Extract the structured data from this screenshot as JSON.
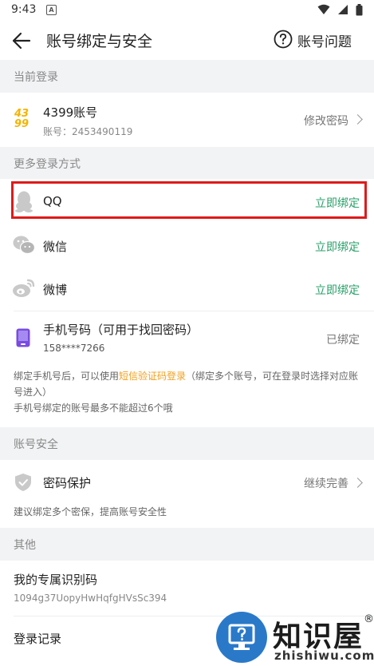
{
  "status_bar": {
    "time": "9:43",
    "app_indicator": "A"
  },
  "header": {
    "title": "账号绑定与安全",
    "help_label": "账号问题"
  },
  "sections": {
    "current_login": "当前登录",
    "more_login": "更多登录方式",
    "account_security": "账号安全",
    "other": "其他"
  },
  "current_account": {
    "logo_top": "43",
    "logo_bottom": "99",
    "title": "4399账号",
    "account_line": "账号：2453490119",
    "action": "修改密码"
  },
  "bindings": [
    {
      "icon": "qq-icon",
      "label": "QQ",
      "action": "立即绑定"
    },
    {
      "icon": "wechat-icon",
      "label": "微信",
      "action": "立即绑定"
    },
    {
      "icon": "weibo-icon",
      "label": "微博",
      "action": "立即绑定"
    }
  ],
  "phone": {
    "title": "手机号码（可用于找回密码）",
    "number": "158****7266",
    "status": "已绑定"
  },
  "phone_note": {
    "prefix": "绑定手机号后，可以使用",
    "highlight": "短信验证码登录",
    "suffix": "（绑定多个账号，可在登录时选择对应账号进入）",
    "line2": "手机号绑定的账号最多不能超过6个哦"
  },
  "password_protect": {
    "title": "密码保护",
    "action": "继续完善",
    "note": "建议绑定多个密保，提高账号安全性"
  },
  "id_code": {
    "title": "我的专属识别码",
    "value": "1094g37UopyHwHqfgHVsSc394"
  },
  "login_record": {
    "title": "登录记录"
  },
  "watermark": {
    "title": "知识屋",
    "reg": "®",
    "domain": "zhishiwu.com"
  },
  "colors": {
    "accent_green": "#2aa06a",
    "highlight_orange": "#f0a020",
    "section_bg": "#f2f3f5",
    "annotation_red": "#e01919"
  }
}
